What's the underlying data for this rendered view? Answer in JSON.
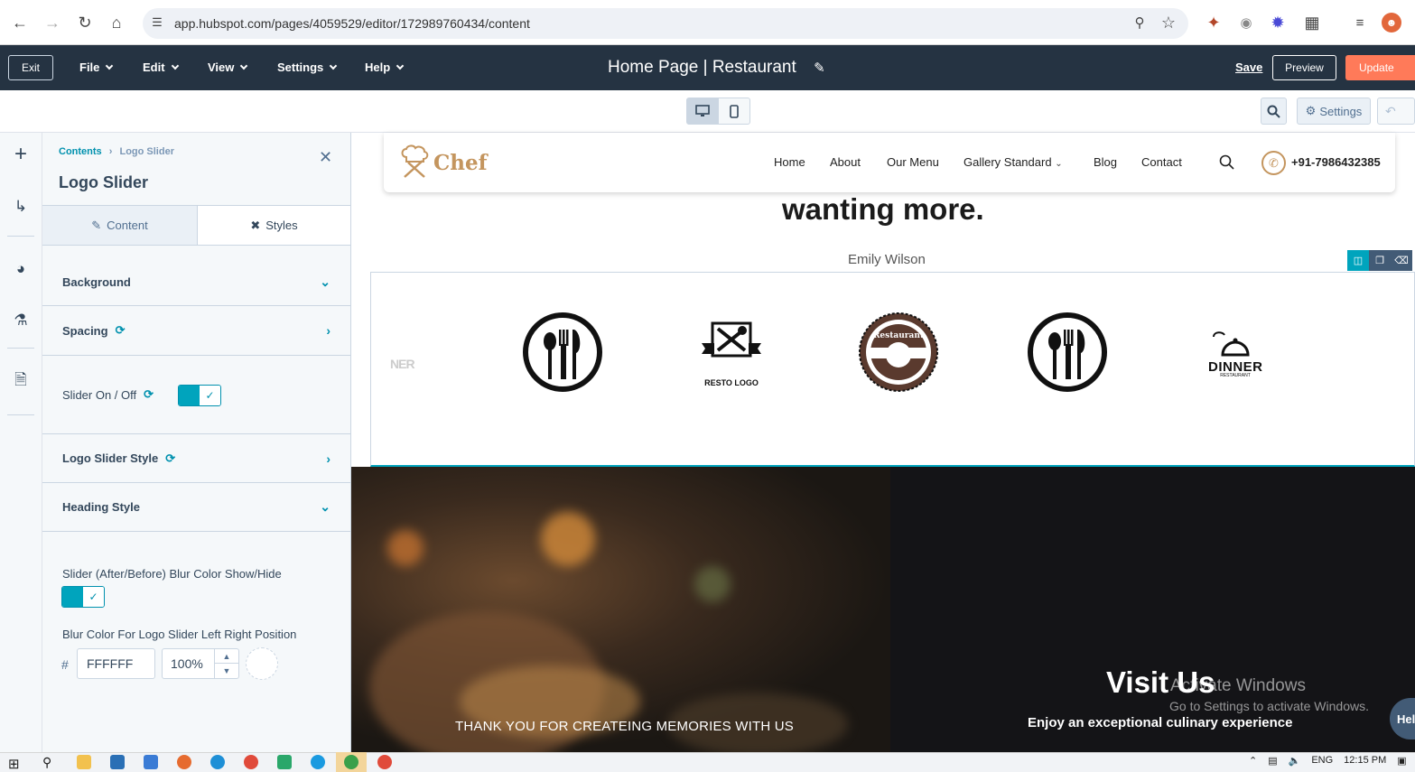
{
  "browser": {
    "url": "app.hubspot.com/pages/4059529/editor/172989760434/content"
  },
  "topbar": {
    "exit_label": "Exit",
    "menus": [
      "File",
      "Edit",
      "View",
      "Settings",
      "Help"
    ],
    "page_title": "Home Page | Restaurant",
    "save_label": "Save",
    "preview_label": "Preview",
    "update_label": "Update"
  },
  "toolbar": {
    "settings_label": "Settings"
  },
  "panel": {
    "breadcrumb_root": "Contents",
    "breadcrumb_current": "Logo Slider",
    "title": "Logo Slider",
    "tab_content": "Content",
    "tab_styles": "Styles",
    "sections": {
      "background": "Background",
      "spacing": "Spacing",
      "slider_onoff": "Slider On / Off",
      "logo_slider_style": "Logo Slider Style",
      "heading_style": "Heading Style"
    },
    "blur_show_label": "Slider (After/Before) Blur Color Show/Hide",
    "blur_color_label": "Blur Color For Logo Slider Left Right Position",
    "hash": "#",
    "color_value": "FFFFFF",
    "opacity_value": "100%"
  },
  "site": {
    "logo_text": "Chef",
    "nav": [
      "Home",
      "About",
      "Our Menu",
      "Gallery Standard",
      "Blog",
      "Contact"
    ],
    "phone": "+91-7986432385",
    "headline": "wanting more.",
    "author": "Emily Wilson",
    "logos": {
      "partial_left": "NER",
      "resto": "RESTO LOGO",
      "restaurant_badge": "Restaurant",
      "dinner": "DINNER",
      "dinner_sub": "RESTAURANT"
    },
    "thanks": "THANK YOU FOR CREATEING MEMORIES WITH US",
    "visit_title": "Visit Us",
    "visit_sub": "Enjoy an exceptional culinary experience"
  },
  "watermark": {
    "line1": "Activate Windows",
    "line2": "Go to Settings to activate Windows."
  },
  "help_label": "Hel",
  "taskbar": {
    "lang": "ENG",
    "time": "12:15 PM"
  }
}
